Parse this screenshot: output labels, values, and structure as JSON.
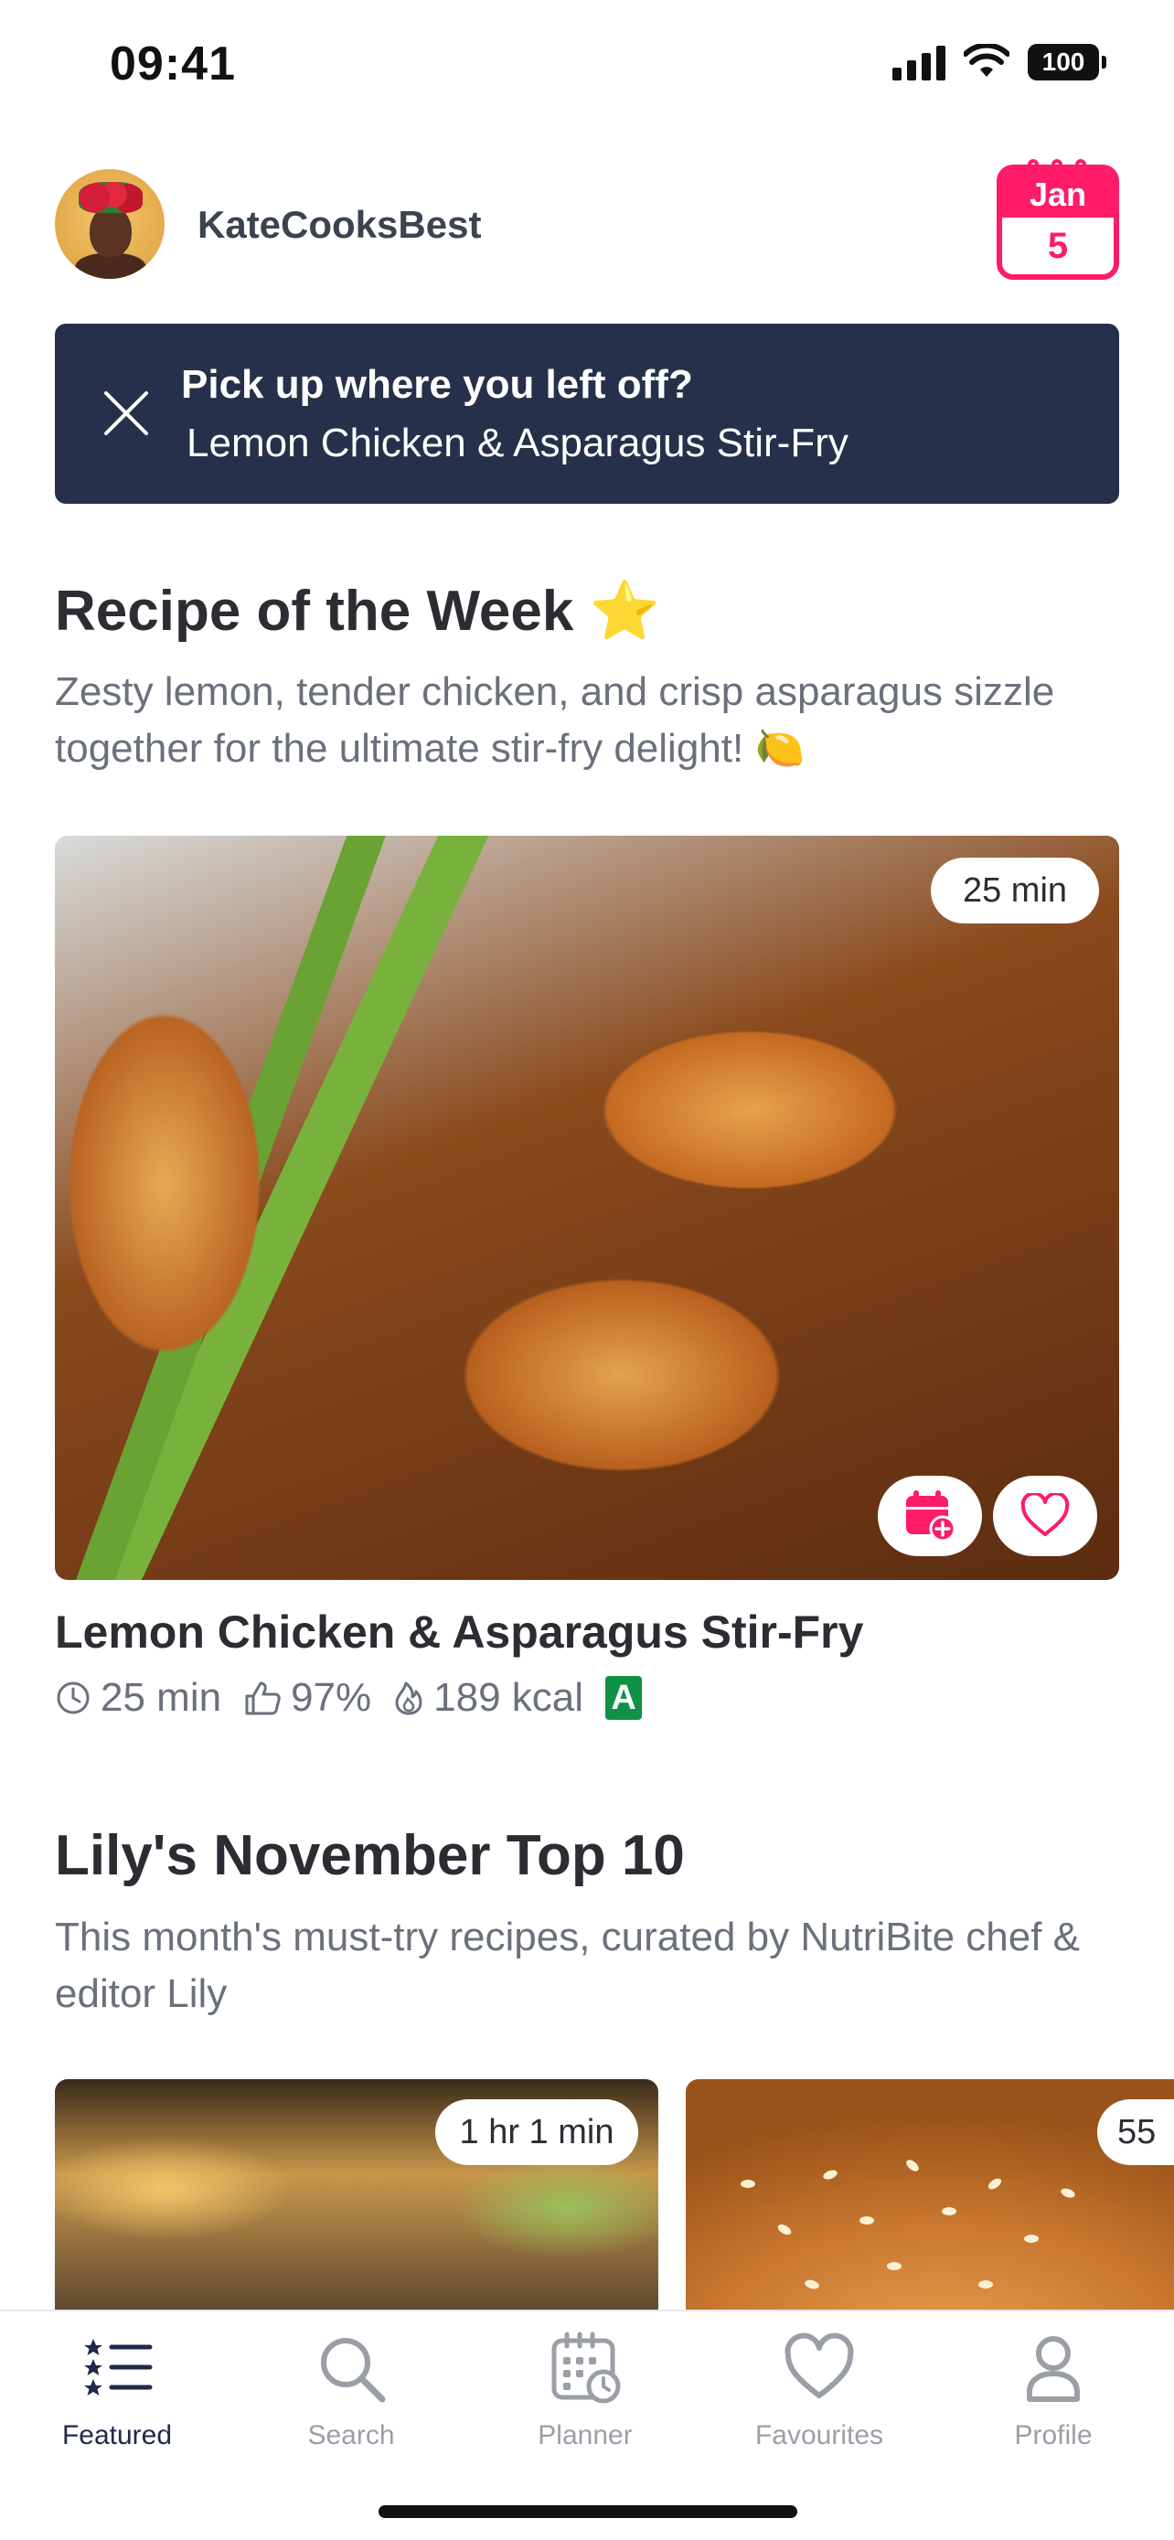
{
  "status_bar": {
    "time": "09:41",
    "battery": "100"
  },
  "header": {
    "username": "KateCooksBest",
    "calendar": {
      "month": "Jan",
      "day": "5"
    }
  },
  "resume_banner": {
    "title": "Pick up where you left off?",
    "recipe": "Lemon Chicken & Asparagus Stir-Fry"
  },
  "recipe_of_week": {
    "title": "Recipe of the Week ⭐",
    "description": "Zesty lemon, tender chicken, and crisp asparagus sizzle together for the ultimate stir-fry delight! 🍋",
    "duration_badge": "25 min",
    "recipe": {
      "name": "Lemon Chicken & Asparagus Stir-Fry",
      "time": "25 min",
      "rating": "97%",
      "calories": "189 kcal",
      "nutri_grade": "A"
    }
  },
  "top10": {
    "title": "Lily's November Top 10",
    "description": "This month's must-try recipes, curated by NutriBite chef & editor Lily",
    "cards": [
      {
        "duration": "1 hr 1 min"
      },
      {
        "duration": "55"
      }
    ]
  },
  "tabbar": {
    "tabs": [
      {
        "label": "Featured",
        "icon": "featured-list-icon",
        "active": true
      },
      {
        "label": "Search",
        "icon": "search-icon",
        "active": false
      },
      {
        "label": "Planner",
        "icon": "planner-calendar-icon",
        "active": false
      },
      {
        "label": "Favourites",
        "icon": "heart-icon",
        "active": false
      },
      {
        "label": "Profile",
        "icon": "profile-icon",
        "active": false
      }
    ]
  },
  "colors": {
    "accent": "#ff1a6a",
    "banner": "#26304a",
    "nutri_a": "#0f9147",
    "active_tab": "#1f2a4a"
  }
}
